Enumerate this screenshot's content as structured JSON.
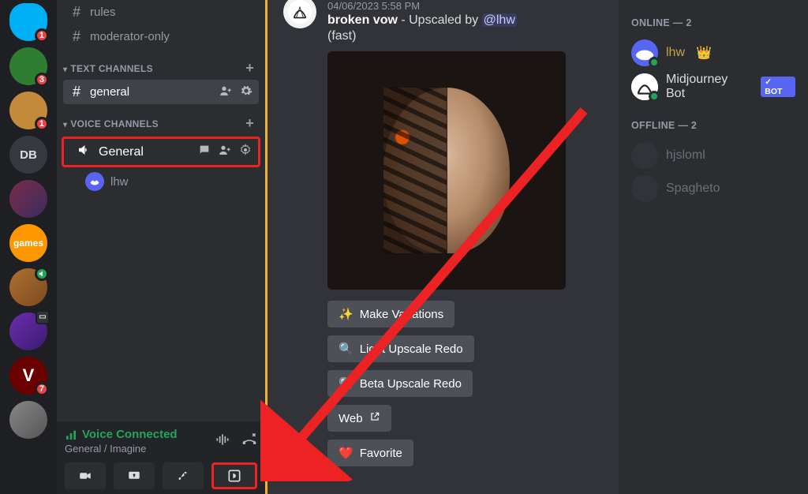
{
  "servers": [
    {
      "key": "blob",
      "label": "",
      "badge": "1"
    },
    {
      "key": "turtle",
      "label": "",
      "badge": "3"
    },
    {
      "key": "cat",
      "label": "",
      "badge": "1"
    },
    {
      "key": "db",
      "label": "DB"
    },
    {
      "key": "abstract",
      "label": ""
    },
    {
      "key": "games",
      "label": "games"
    },
    {
      "key": "food",
      "label": "",
      "green": true
    },
    {
      "key": "purple",
      "label": "",
      "calendar": true
    },
    {
      "key": "v",
      "label": "V",
      "badge": "7"
    },
    {
      "key": "last",
      "label": ""
    }
  ],
  "channels": {
    "top": [
      {
        "icon": "#",
        "name": "rules"
      },
      {
        "icon": "#",
        "name": "moderator-only",
        "lockish": true
      }
    ],
    "text_header": "TEXT CHANNELS",
    "text": [
      {
        "icon": "#",
        "name": "general",
        "active": true
      }
    ],
    "voice_header": "VOICE CHANNELS",
    "voice_channel": "General",
    "voice_users": [
      {
        "name": "lhw"
      }
    ]
  },
  "voice_panel": {
    "status": "Voice Connected",
    "sub": "General / Imagine"
  },
  "message": {
    "timestamp": "04/06/2023 5:58 PM",
    "prompt": "broken vow",
    "desc": " - Upscaled by ",
    "mention": "@lhw",
    "tail": "(fast)",
    "buttons": [
      {
        "emoji": "✨",
        "label": "Make Variations"
      },
      {
        "emoji": "🔍",
        "label": "Light Upscale Redo"
      },
      {
        "emoji": "🔍",
        "label": "Beta Upscale Redo"
      },
      {
        "emoji": "↗",
        "label": "Web",
        "web": true
      },
      {
        "emoji": "❤️",
        "label": "Favorite"
      }
    ]
  },
  "members": {
    "online_header": "ONLINE — 2",
    "online": [
      {
        "name": "lhw",
        "crown": true,
        "status": "#23a559",
        "avbg": "#5865f2"
      },
      {
        "name": "Midjourney Bot",
        "bot": true,
        "status": "#23a559",
        "avbg": "#f2f3f5"
      }
    ],
    "offline_header": "OFFLINE — 2",
    "offline": [
      {
        "name": "hjsloml",
        "avbg": "#3a3c42"
      },
      {
        "name": "Spagheto",
        "avbg": "#3a3c42"
      }
    ],
    "bot_tag": "BOT"
  }
}
